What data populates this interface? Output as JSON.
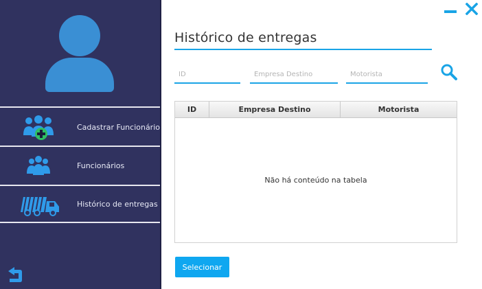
{
  "sidebar": {
    "items": [
      {
        "label": "Cadastrar Funcionário",
        "icon": "add-user-group-icon"
      },
      {
        "label": "Funcionários",
        "icon": "users-group-icon"
      },
      {
        "label": "Histórico de entregas",
        "icon": "delivery-truck-icon"
      }
    ],
    "back_icon": "back-arrow-icon"
  },
  "main": {
    "title": "Histórico de entregas",
    "filters": {
      "id_placeholder": "ID",
      "empresa_placeholder": "Empresa Destino",
      "motorista_placeholder": "Motorista"
    },
    "table": {
      "columns": [
        "ID",
        "Empresa Destino",
        "Motorista"
      ],
      "rows": [],
      "empty_message": "Não há conteúdo na tabela"
    },
    "select_button": "Selecionar"
  },
  "colors": {
    "sidebar_bg": "#30325f",
    "accent": "#19a4e6",
    "icon_blue": "#3a8fd4",
    "button": "#0fa7f0"
  }
}
